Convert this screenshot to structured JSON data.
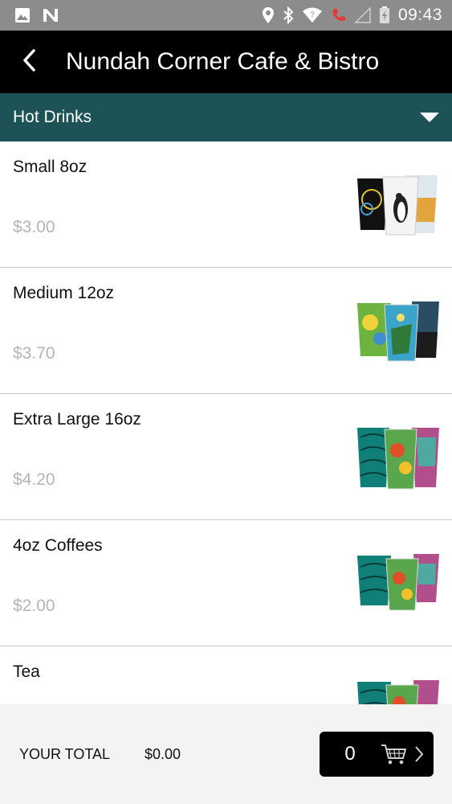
{
  "status_bar": {
    "time": "09:43",
    "icons": [
      "image-icon",
      "n-icon",
      "location-icon",
      "bluetooth-icon",
      "wifi-icon",
      "call-icon",
      "signal-icon",
      "battery-icon"
    ]
  },
  "app_bar": {
    "title": "Nundah Corner Cafe & Bistro",
    "back_icon": "back-arrow-icon"
  },
  "category": {
    "label": "Hot Drinks",
    "icon": "dropdown-caret-icon"
  },
  "items": [
    {
      "name": "Small 8oz",
      "price": "$3.00"
    },
    {
      "name": "Medium 12oz",
      "price": "$3.70"
    },
    {
      "name": "Extra Large 16oz",
      "price": "$4.20"
    },
    {
      "name": "4oz Coffees",
      "price": "$2.00"
    },
    {
      "name": "Tea",
      "price": ""
    }
  ],
  "footer": {
    "total_label": "YOUR TOTAL",
    "total_value": "$0.00",
    "cart_count": "0",
    "cart_icon": "cart-icon"
  },
  "colors": {
    "status_bar_bg": "#8c8c8c",
    "app_bar_bg": "#000000",
    "category_bg": "#1d5356",
    "price_text": "#b5b5b5",
    "footer_bg": "#f3f3f1"
  }
}
